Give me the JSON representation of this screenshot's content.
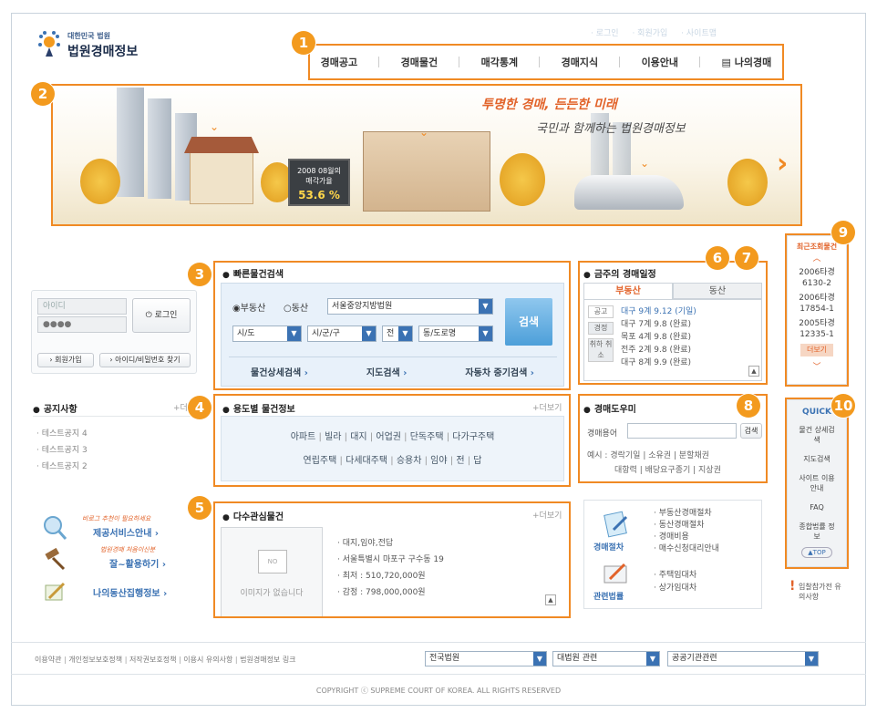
{
  "brand": {
    "small": "대한민국 법원",
    "title": "법원경매정보"
  },
  "util": [
    "· 로그인",
    "· 회원가입",
    "· 사이트맵"
  ],
  "gnb": [
    "경매공고",
    "경매물건",
    "매각통계",
    "경매지식",
    "이용안내",
    "나의경매"
  ],
  "banner": {
    "slogan1": "투명한 경매, 든든한 미래",
    "slogan2": "국민과 함께하는 법원경매정보",
    "sign_line1": "2008 08월의",
    "sign_line2": "매각가율",
    "sign_rate": "53.6 %"
  },
  "login": {
    "id_placeholder": "아이디",
    "pw_mask": "●●●●",
    "login_btn": "로그인",
    "join": "› 회원가입",
    "find": "› 아이디/비밀번호 찾기"
  },
  "quick_search": {
    "title": "빠른물건검색",
    "radio1": "부동산",
    "radio2": "동산",
    "court": "서울중앙지방법원",
    "sido": "시/도",
    "sigungu": "시/군/구",
    "jeon": "전",
    "dong": "동/도로명",
    "search": "검색",
    "links": [
      "물건상세검색",
      "지도검색",
      "자동차 중기검색"
    ]
  },
  "notice": {
    "title": "공지사항",
    "more": "+더",
    "items": [
      "· 테스트공지 4",
      "· 테스트공지 3",
      "· 테스트공지 2"
    ]
  },
  "usage": {
    "title": "용도별 물건정보",
    "more": "+더보기",
    "row1": [
      "아파트",
      "빌라",
      "대지",
      "어업권",
      "단독주택",
      "다가구주택"
    ],
    "row2": [
      "연립주택",
      "다세대주택",
      "승용차",
      "임야",
      "전",
      "답"
    ]
  },
  "interest": {
    "title": "다수관심물건",
    "more": "+더보기",
    "noimg": "이미지가 없습니다",
    "no": "NO",
    "lines": [
      "· 대지,임야,전답",
      "· 서울특별시 마포구 구수동 19",
      "· 최저 : 510,720,000원",
      "· 감정 : 798,000,000원"
    ]
  },
  "services": {
    "s1_tag": "비로그 추천이 필요하세요",
    "s1": "제공서비스안내",
    "s2_tag": "법원경매 처음이신분",
    "s2": "잘~활용하기",
    "s3": "나의동산집행정보"
  },
  "schedule": {
    "title": "금주의 경매일정",
    "tab1": "부동산",
    "tab2": "동산",
    "side": [
      "공고",
      "경정",
      "취하 취소"
    ],
    "rows": [
      "대구 9계 9.12 (기일)",
      "대구 7계 9.8 (완료)",
      "목포 4계 9.8 (완료)",
      "전주 2계 9.8 (완료)",
      "대구 8계 9.9 (완료)"
    ]
  },
  "helper": {
    "title": "경매도우미",
    "term_label": "경매용어",
    "search": "검색",
    "ex_label": "예시 :",
    "ex1": "경락기일 | 소유권 | 분할채권",
    "ex2": "대항력 | 배당요구종기 | 지상권"
  },
  "procedure": {
    "label1": "경매절차",
    "items1": [
      "· 부동산경매절차",
      "· 동산경매절차",
      "· 경매비용",
      "· 매수신청대리안내"
    ],
    "label2": "관련법률",
    "items2": [
      "· 주택임대차",
      "· 상가임대차"
    ]
  },
  "recent": {
    "title": "최근조회물건",
    "items": [
      "2006타경 6130-2",
      "2006타경 17854-1",
      "2005타경 12335-1"
    ],
    "more": "더보기"
  },
  "quick": {
    "title": "QUICK",
    "items": [
      "물건 상세검색",
      "지도검색",
      "사이트 이용안내",
      "FAQ",
      "종합법률 정보"
    ],
    "top": "▲TOP"
  },
  "notice_side": "입찰참가전 유의사항",
  "footer": {
    "links": [
      "이용약관",
      "개인정보보호정책",
      "저작권보호정책",
      "이용시 유의사항",
      "법원경매정보 링크"
    ],
    "sel1": "전국법원",
    "sel2": "대법원 관련",
    "sel3": "공공기관관련",
    "copyright": "COPYRIGHT ⓒ SUPREME COURT OF KOREA. ALL RIGHTS RESERVED"
  },
  "markers": [
    "1",
    "2",
    "3",
    "4",
    "5",
    "6",
    "7",
    "8",
    "9",
    "10"
  ],
  "colors": {
    "accent": "#f08a24",
    "blue": "#3b72b3"
  }
}
